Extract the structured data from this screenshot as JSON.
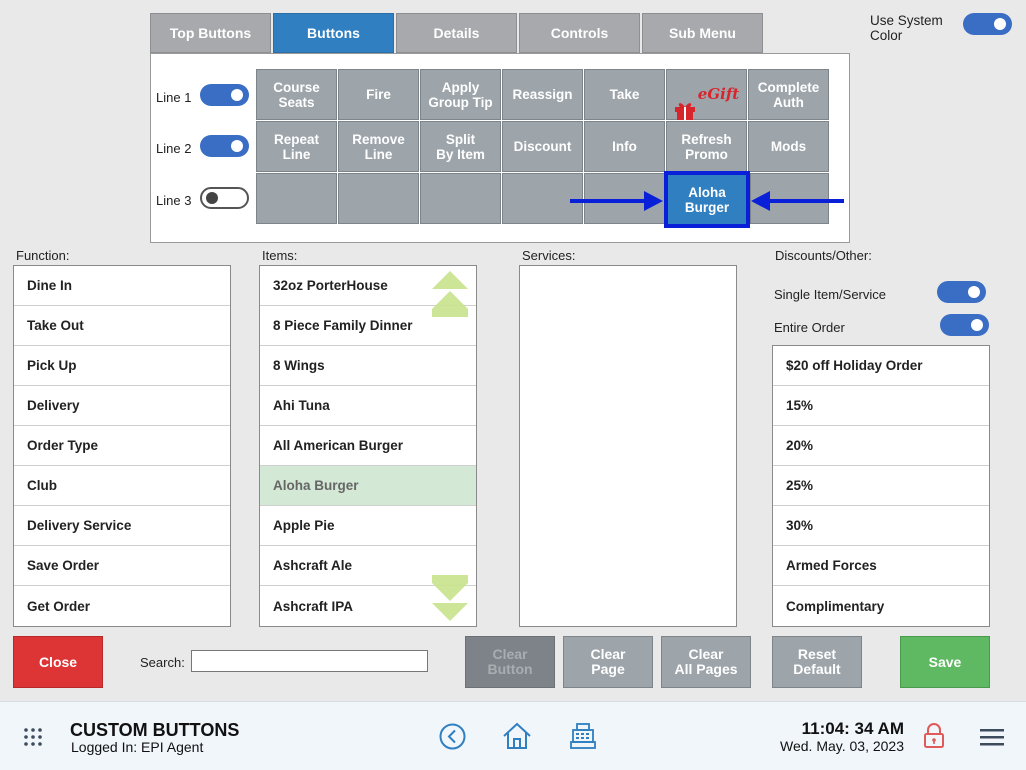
{
  "tabs": [
    "Top Buttons",
    "Buttons",
    "Details",
    "Controls",
    "Sub Menu"
  ],
  "system_color": {
    "label_line1": "Use System",
    "label_line2": "Color",
    "on": true
  },
  "lines": [
    {
      "label": "Line 1",
      "on": true
    },
    {
      "label": "Line 2",
      "on": true
    },
    {
      "label": "Line 3",
      "on": false
    }
  ],
  "grid": {
    "row1": [
      "Course\nSeats",
      "Fire",
      "Apply\nGroup Tip",
      "Reassign",
      "Take",
      "eGift",
      "Complete\nAuth"
    ],
    "row2": [
      "Repeat\nLine",
      "Remove\nLine",
      "Split\nBy Item",
      "Discount",
      "Info",
      "Refresh\nPromo",
      "Mods"
    ],
    "row3_selected": "Aloha\nBurger",
    "egift_text": "eGift"
  },
  "headings": {
    "function": "Function:",
    "items": "Items:",
    "services": "Services:",
    "discounts": "Discounts/Other:"
  },
  "functions": [
    "Dine In",
    "Take Out",
    "Pick Up",
    "Delivery",
    "Order Type",
    "Club",
    "Delivery Service",
    "Save Order",
    "Get Order"
  ],
  "items": [
    "32oz PorterHouse",
    "8 Piece Family Dinner",
    "8 Wings",
    "Ahi Tuna",
    "All American Burger",
    "Aloha Burger",
    "Apple Pie",
    "Ashcraft Ale",
    "Ashcraft IPA"
  ],
  "discount_toggles": [
    {
      "label": "Single Item/Service",
      "on": true
    },
    {
      "label": "Entire Order",
      "on": true
    }
  ],
  "discounts": [
    "$20 off Holiday Order",
    "15%",
    "20%",
    "25%",
    "30%",
    "Armed Forces",
    "Complimentary"
  ],
  "actions": {
    "close": "Close",
    "search_label": "Search:",
    "search_value": "",
    "clear_button": "Clear\nButton",
    "clear_page": "Clear\nPage",
    "clear_all": "Clear\nAll Pages",
    "reset_default": "Reset\nDefault",
    "save": "Save"
  },
  "colors": {
    "accent": "#2f7fc1",
    "close": "#dd3535",
    "save": "#5fb963",
    "selection": "#0a1fd8",
    "highlight": "#d3e8d5"
  },
  "footer": {
    "title": "CUSTOM BUTTONS",
    "logged_in": "Logged In:  EPI Agent",
    "time": "11:04: 34 AM",
    "date": "Wed. May. 03, 2023"
  }
}
